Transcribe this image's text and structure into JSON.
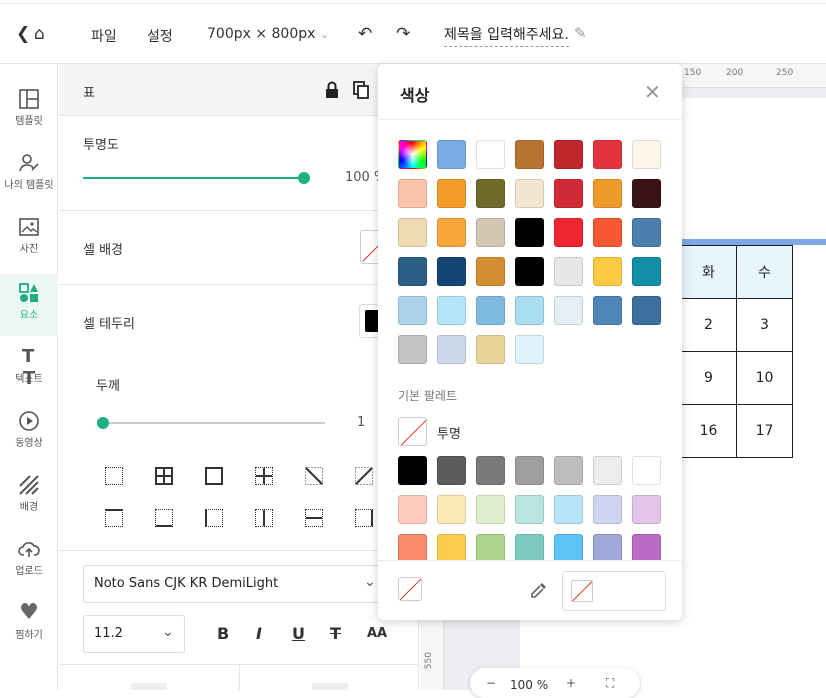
{
  "topbar": {
    "back_icon": "chevron-left-icon",
    "home_icon": "home-icon",
    "file_menu": "파일",
    "settings_menu": "설정",
    "size": "700px × 800px",
    "title": "제목을 입력해주세요."
  },
  "sidebar": {
    "items": [
      {
        "label": "템플릿",
        "icon": "template-icon"
      },
      {
        "label": "나의 템플릿",
        "icon": "my-template-icon"
      },
      {
        "label": "사진",
        "icon": "photo-icon"
      },
      {
        "label": "요소",
        "icon": "elements-icon",
        "active": true
      },
      {
        "label": "텍스트",
        "icon": "text-icon"
      },
      {
        "label": "동영상",
        "icon": "video-icon"
      },
      {
        "label": "배경",
        "icon": "background-icon"
      },
      {
        "label": "업로드",
        "icon": "upload-icon"
      },
      {
        "label": "찜하기",
        "icon": "heart-icon"
      }
    ]
  },
  "panel": {
    "title": "표",
    "opacity_label": "투명도",
    "opacity_value": "100",
    "opacity_unit": "%",
    "cell_bg_label": "셀 배경",
    "cell_border_label": "셀 테두리",
    "thickness_label": "두께",
    "thickness_value": "1",
    "font_name": "Noto Sans CJK KR DemiLight",
    "font_size": "11.2"
  },
  "canvas": {
    "ruler_top": [
      "150",
      "200",
      "250"
    ],
    "ruler_left": [
      "550"
    ],
    "zoom": "100 %",
    "table": {
      "header": [
        "화",
        "수"
      ],
      "rows": [
        [
          "2",
          "3"
        ],
        [
          "9",
          "10"
        ],
        [
          "16",
          "17"
        ]
      ]
    }
  },
  "color_popup": {
    "title": "색상",
    "basic_palette_label": "기본 팔레트",
    "transparent_label": "투명",
    "recent_colors": [
      "rainbow",
      "#7aabe6",
      "#ffffff",
      "#b87333",
      "#c0272d",
      "#e2343e",
      "#fff6e9",
      "#fbc3a9",
      "#f39c2b",
      "#6e6a2a",
      "#f3e6cf",
      "#d12a37",
      "#ee9b2c",
      "#3b1317",
      "#f0dab3",
      "#f8a53b",
      "#d3c6b3",
      "#000000",
      "#ef2530",
      "#f75733",
      "#4c7fad",
      "#2b5f86",
      "#154575",
      "#d48d30",
      "#000000",
      "#e7e7e7",
      "#fcca43",
      "#148ea6",
      "#acd2ec",
      "#b3e4f7",
      "#7fbbe1",
      "#a9ddf1",
      "#e3eef5",
      "#4f86b8",
      "#3c6f9e",
      "#c3c3c3",
      "#cbd8ea",
      "#e9d59a",
      "#dff3fb"
    ],
    "basic_colors": [
      "#000000",
      "#5b5b5b",
      "#7a7a7a",
      "#9e9e9e",
      "#bdbdbd",
      "#ececec",
      "#ffffff",
      "#fdcbbd",
      "#fde9b5",
      "#e1eece",
      "#b9e5df",
      "#b6e3f7",
      "#cfd5f0",
      "#e3c5ea",
      "#fc8b6b",
      "#fdcd4d",
      "#acd48b",
      "#7ecac2",
      "#5bc4f5",
      "#9fa8d6",
      "#b86cc3"
    ]
  }
}
